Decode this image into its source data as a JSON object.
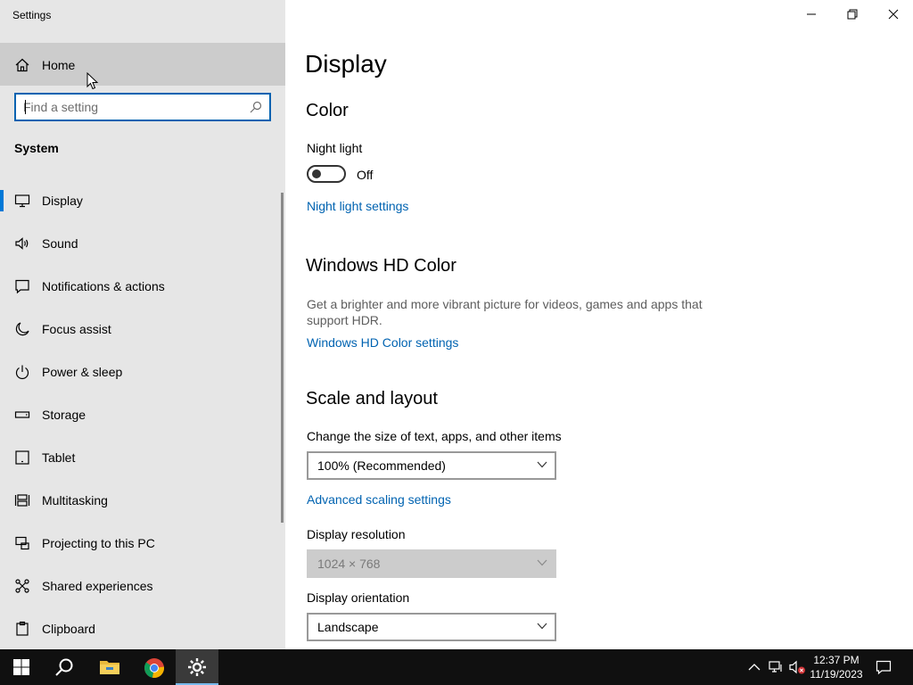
{
  "window": {
    "title": "Settings"
  },
  "sidebar": {
    "home_label": "Home",
    "search_placeholder": "Find a setting",
    "section": "System",
    "items": [
      {
        "label": "Display",
        "icon": "monitor-icon"
      },
      {
        "label": "Sound",
        "icon": "speaker-icon"
      },
      {
        "label": "Notifications & actions",
        "icon": "notification-icon"
      },
      {
        "label": "Focus assist",
        "icon": "moon-icon"
      },
      {
        "label": "Power & sleep",
        "icon": "power-icon"
      },
      {
        "label": "Storage",
        "icon": "storage-icon"
      },
      {
        "label": "Tablet",
        "icon": "tablet-icon"
      },
      {
        "label": "Multitasking",
        "icon": "multitasking-icon"
      },
      {
        "label": "Projecting to this PC",
        "icon": "projector-icon"
      },
      {
        "label": "Shared experiences",
        "icon": "share-icon"
      },
      {
        "label": "Clipboard",
        "icon": "clipboard-icon"
      }
    ]
  },
  "main": {
    "title": "Display",
    "color": {
      "heading": "Color",
      "night_light_label": "Night light",
      "night_light_state": "Off",
      "night_light_link": "Night light settings"
    },
    "hd": {
      "heading": "Windows HD Color",
      "description": "Get a brighter and more vibrant picture for videos, games and apps that support HDR.",
      "link": "Windows HD Color settings"
    },
    "scale": {
      "heading": "Scale and layout",
      "size_label": "Change the size of text, apps, and other items",
      "size_value": "100% (Recommended)",
      "advanced_link": "Advanced scaling settings",
      "resolution_label": "Display resolution",
      "resolution_value": "1024 × 768",
      "orientation_label": "Display orientation",
      "orientation_value": "Landscape"
    }
  },
  "taskbar": {
    "time": "12:37 PM",
    "date": "11/19/2023"
  },
  "colors": {
    "accent": "#0078d7",
    "link": "#0063b1",
    "sidebar_bg": "#e6e6e6",
    "taskbar_bg": "#101010"
  }
}
